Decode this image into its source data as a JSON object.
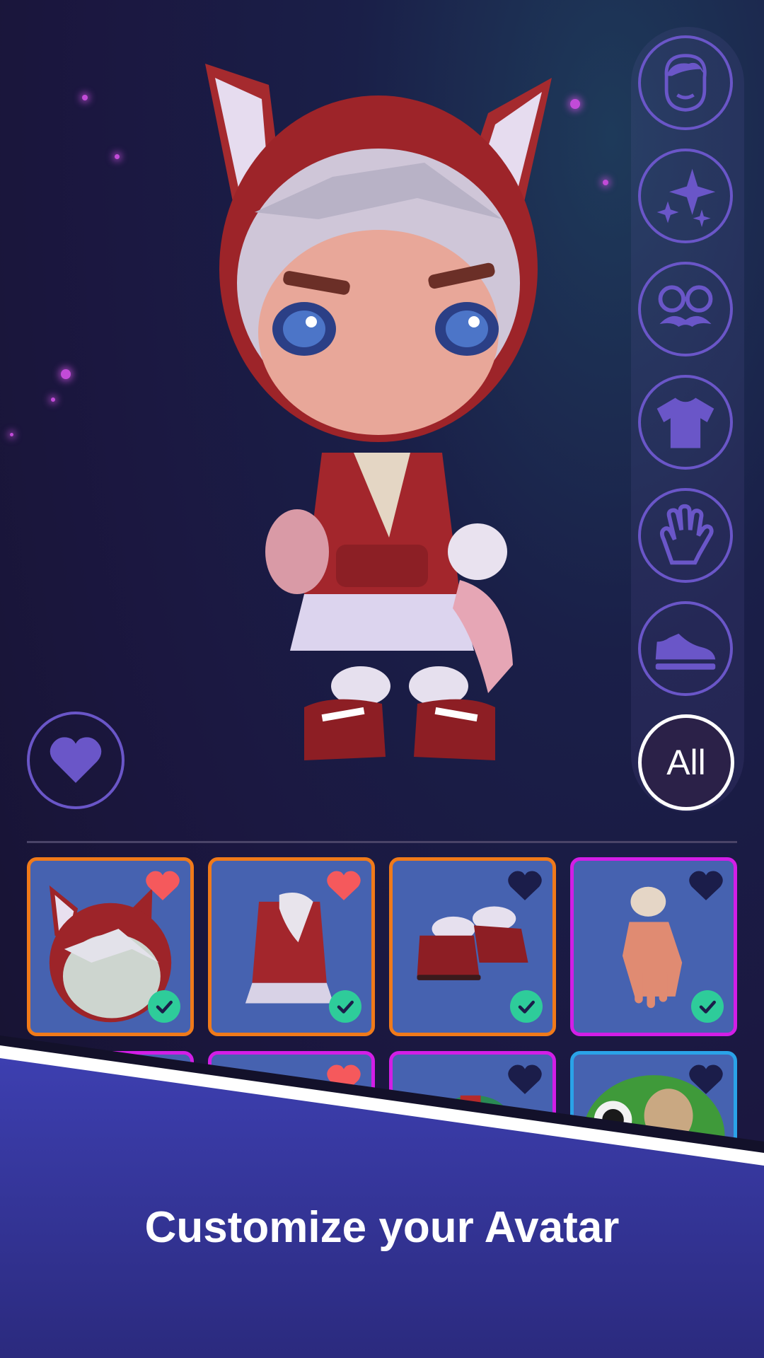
{
  "categories": [
    {
      "name": "head-category",
      "icon": "face-icon"
    },
    {
      "name": "effects-category",
      "icon": "sparkles-icon"
    },
    {
      "name": "face-accessories-category",
      "icon": "glasses-mustache-icon"
    },
    {
      "name": "tops-category",
      "icon": "tshirt-icon"
    },
    {
      "name": "gloves-category",
      "icon": "glove-icon"
    },
    {
      "name": "shoes-category",
      "icon": "sneaker-icon"
    }
  ],
  "all_button_label": "All",
  "favorite_button_icon": "heart-icon",
  "items": [
    {
      "name": "fox-hood-head",
      "favorited": true,
      "owned": true,
      "border": "#f07a1a"
    },
    {
      "name": "red-hoodie-outfit",
      "favorited": true,
      "owned": true,
      "border": "#f07a1a"
    },
    {
      "name": "red-boots",
      "favorited": false,
      "owned": true,
      "border": "#f07a1a"
    },
    {
      "name": "pink-hand",
      "favorited": false,
      "owned": true,
      "border": "#d21ee6"
    },
    {
      "name": "item-row2-1",
      "favorited": false,
      "owned": false,
      "border": "#d21ee6"
    },
    {
      "name": "item-row2-2",
      "favorited": true,
      "owned": false,
      "border": "#d21ee6"
    },
    {
      "name": "item-row2-3",
      "favorited": false,
      "owned": false,
      "border": "#d21ee6"
    },
    {
      "name": "frog-hat",
      "favorited": false,
      "owned": false,
      "border": "#2aa3e8"
    }
  ],
  "colors": {
    "heart_favorited": "#f5595c",
    "heart_unfavorited": "#1b1d4a",
    "check": "#2ecc9a",
    "accent": "#6a56c8"
  },
  "banner": {
    "headline": "Customize your Avatar"
  }
}
